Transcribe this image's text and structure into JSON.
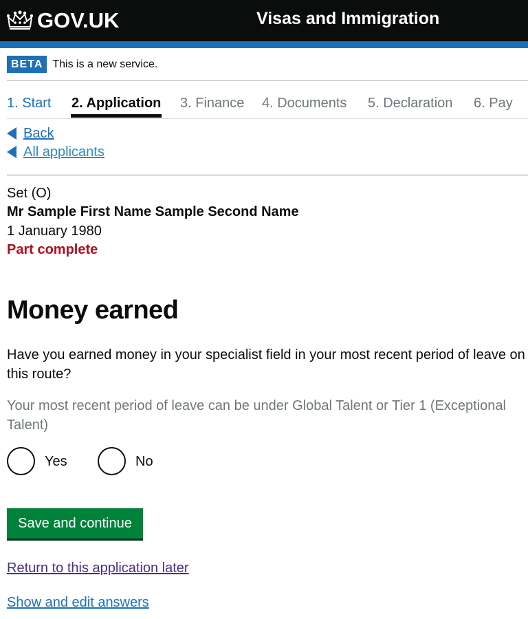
{
  "header": {
    "logo_text": "GOV.UK",
    "service_name": "Visas and Immigration"
  },
  "beta": {
    "tag": "BETA",
    "text": "This is a new service."
  },
  "steps": [
    {
      "label": "1. Start",
      "state": "link"
    },
    {
      "label": "2. Application",
      "state": "current"
    },
    {
      "label": "3. Finance",
      "state": "inactive"
    },
    {
      "label": "4. Documents",
      "state": "inactive"
    },
    {
      "label": "5. Declaration",
      "state": "inactive"
    },
    {
      "label": "6. Pay",
      "state": "inactive"
    }
  ],
  "nav": {
    "back": "Back",
    "all_applicants": "All applicants"
  },
  "applicant": {
    "set": "Set (O)",
    "name": "Mr Sample First Name Sample Second Name",
    "dob": "1 January 1980",
    "status": "Part complete"
  },
  "main": {
    "heading": "Money earned",
    "question": "Have you earned money in your specialist field in your most recent period of leave on this route?",
    "hint": "Your most recent period of leave can be under Global Talent or Tier 1 (Exceptional Talent)",
    "options": [
      "Yes",
      "No"
    ],
    "submit": "Save and continue",
    "return_link": "Return to this application later",
    "show_link": "Show and edit answers"
  },
  "colors": {
    "header_bg": "#0b0c0c",
    "brand_blue": "#1d70b8",
    "button_green": "#00823b",
    "status_red": "#b10e1e",
    "visited_purple": "#4c2c92"
  }
}
